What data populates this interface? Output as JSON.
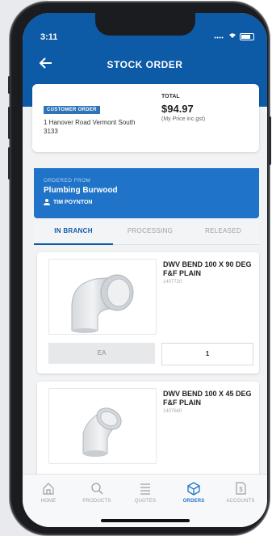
{
  "status": {
    "time": "3:11"
  },
  "nav": {
    "back_icon": "arrow-left-icon",
    "title": "STOCK ORDER"
  },
  "order_card": {
    "badge": "CUSTOMER ORDER",
    "address": "1 Hanover Road  Vermont South 3133",
    "total_label": "TOTAL",
    "total_value": "$94.97",
    "total_note": "(My Price inc.gst)"
  },
  "branch": {
    "label": "ORDERED FROM",
    "name": "Plumbing Burwood",
    "user": "TIM POYNTON"
  },
  "tabs": [
    {
      "label": "IN BRANCH",
      "active": true
    },
    {
      "label": "PROCESSING",
      "active": false
    },
    {
      "label": "RELEASED",
      "active": false
    }
  ],
  "products": [
    {
      "name": "DWV BEND 100 X 90 DEG F&F PLAIN",
      "code": "1407720",
      "unit": "EA",
      "qty": "1"
    },
    {
      "name": "DWV BEND 100 X 45 DEG F&F PLAIN",
      "code": "1407660"
    }
  ],
  "tabbar": [
    {
      "label": "HOME",
      "icon": "home-icon"
    },
    {
      "label": "PRODUCTS",
      "icon": "search-icon"
    },
    {
      "label": "QUOTES",
      "icon": "list-icon"
    },
    {
      "label": "ORDERS",
      "icon": "box-icon",
      "active": true
    },
    {
      "label": "ACCOUNTS",
      "icon": "document-dollar-icon"
    }
  ],
  "colors": {
    "primary": "#0d5aa7",
    "accent": "#1f73c8"
  }
}
